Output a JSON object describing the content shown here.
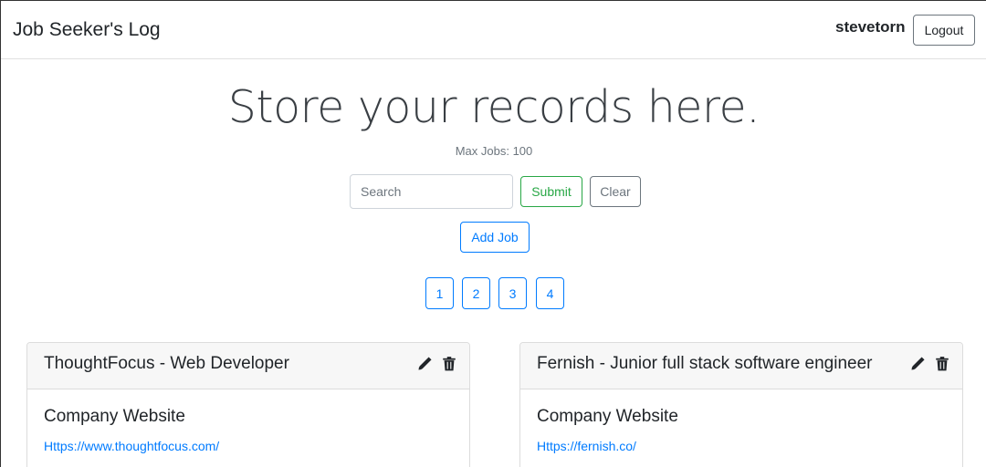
{
  "header": {
    "brand": "Job Seeker's Log",
    "username": "stevetorn",
    "logout_label": "Logout"
  },
  "hero": {
    "title": "Store your records here.",
    "max_jobs": "Max Jobs: 100"
  },
  "search": {
    "placeholder": "Search",
    "value": "",
    "submit_label": "Submit",
    "clear_label": "Clear"
  },
  "actions": {
    "add_job_label": "Add Job"
  },
  "pagination": [
    "1",
    "2",
    "3",
    "4"
  ],
  "jobs": [
    {
      "title": "ThoughtFocus - Web Developer",
      "website_label": "Company Website",
      "website_url": "Https://www.thoughtfocus.com/",
      "edit_icon": "pencil-icon",
      "delete_icon": "trash-icon"
    },
    {
      "title": "Fernish - Junior full stack software engineer",
      "website_label": "Company Website",
      "website_url": "Https://fernish.co/",
      "edit_icon": "pencil-icon",
      "delete_icon": "trash-icon"
    }
  ],
  "colors": {
    "primary": "#007bff",
    "success": "#28a745",
    "secondary": "#6c757d",
    "card_header_bg": "#f7f7f7"
  }
}
